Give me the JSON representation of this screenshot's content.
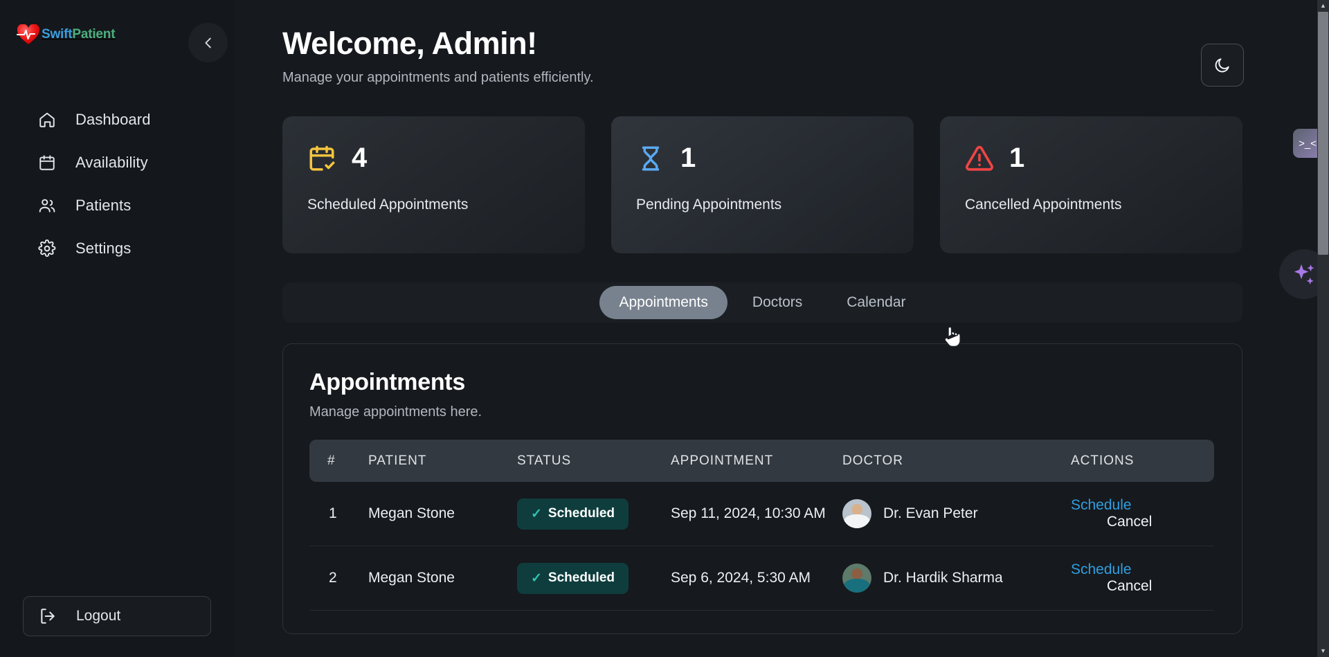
{
  "brand": {
    "swift": "Swift",
    "patient": "Patient",
    "heart_icon": "heart-pulse-icon"
  },
  "sidebar": {
    "collapse_icon": "chevron-left-icon",
    "items": [
      {
        "label": "Dashboard",
        "icon": "home-icon"
      },
      {
        "label": "Availability",
        "icon": "calendar-icon"
      },
      {
        "label": "Patients",
        "icon": "users-icon"
      },
      {
        "label": "Settings",
        "icon": "gear-icon"
      }
    ],
    "logout": {
      "label": "Logout",
      "icon": "logout-icon"
    }
  },
  "header": {
    "title": "Welcome, Admin!",
    "subtitle": "Manage your appointments and patients efficiently.",
    "theme_toggle_icon": "moon-icon"
  },
  "stats": [
    {
      "value": "4",
      "label": "Scheduled Appointments",
      "icon": "calendar-check-icon",
      "color": "#f5c53d"
    },
    {
      "value": "1",
      "label": "Pending Appointments",
      "icon": "hourglass-icon",
      "color": "#5aa9f0"
    },
    {
      "value": "1",
      "label": "Cancelled Appointments",
      "icon": "triangle-alert-icon",
      "color": "#f04444"
    }
  ],
  "tabs": [
    {
      "label": "Appointments",
      "active": true
    },
    {
      "label": "Doctors",
      "active": false
    },
    {
      "label": "Calendar",
      "active": false
    }
  ],
  "panel": {
    "title": "Appointments",
    "subtitle": "Manage appointments here.",
    "columns": [
      "#",
      "PATIENT",
      "STATUS",
      "APPOINTMENT",
      "DOCTOR",
      "ACTIONS"
    ],
    "rows": [
      {
        "index": "1",
        "patient": "Megan Stone",
        "status": "Scheduled",
        "status_check": "✓",
        "appointment": "Sep 11, 2024, 10:30 AM",
        "doctor": "Dr. Evan Peter",
        "doctor_avatar": "doctor-avatar-1",
        "action_primary": "Schedule",
        "action_secondary": "Cancel"
      },
      {
        "index": "2",
        "patient": "Megan Stone",
        "status": "Scheduled",
        "status_check": "✓",
        "appointment": "Sep 6, 2024, 5:30 AM",
        "doctor": "Dr. Hardik Sharma",
        "doctor_avatar": "doctor-avatar-2",
        "action_primary": "Schedule",
        "action_secondary": "Cancel"
      }
    ]
  },
  "rail": {
    "emote_label": ">_<",
    "emote_icon": "emoticon-icon",
    "sparkle_icon": "sparkles-icon"
  },
  "scrollbar": {
    "up_arrow": "▲",
    "down_arrow": "▼"
  },
  "colors": {
    "page_bg": "#16191d",
    "sidebar_bg": "#14171b",
    "accent_link": "#2f9fe0",
    "badge_bg": "#0f3d3d",
    "badge_check": "#2ec4b6",
    "tab_active_bg": "#78828e"
  }
}
